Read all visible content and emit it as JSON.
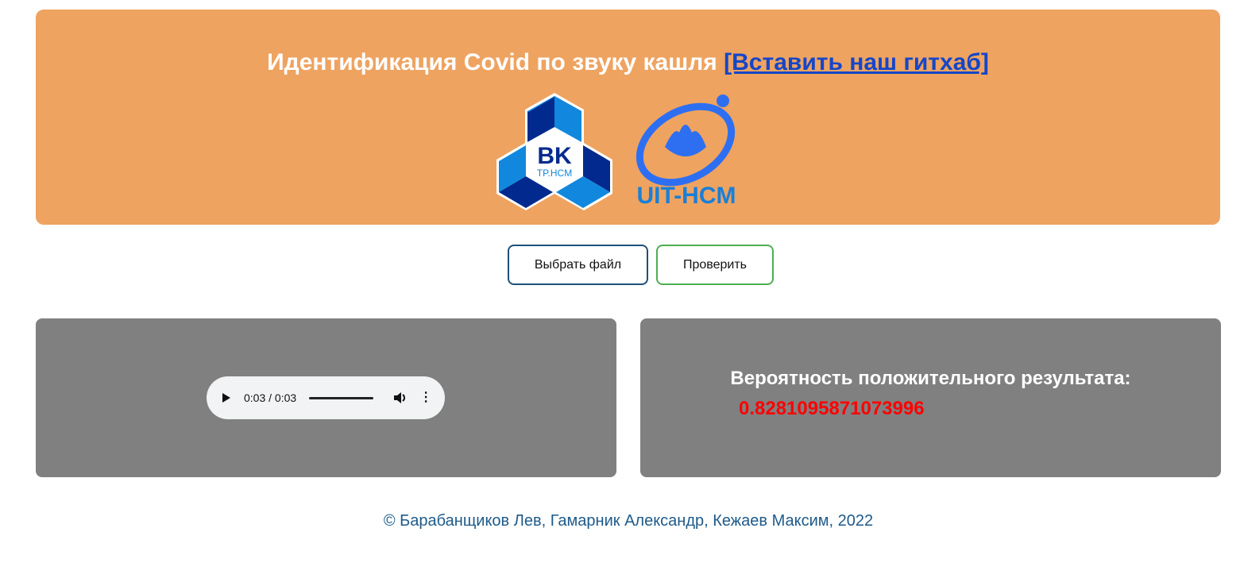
{
  "header": {
    "title": "Идентификация Covid по звуку кашля",
    "link_text": "[Вставить наш гитхаб]",
    "logos": [
      {
        "name": "BK",
        "subtitle": "TP.HCM"
      },
      {
        "name": "UIT-HCM"
      }
    ]
  },
  "actions": {
    "choose_file": "Выбрать файл",
    "check": "Проверить"
  },
  "audio": {
    "time": "0:03 / 0:03",
    "progress": 1.0
  },
  "result": {
    "label": "Вероятность положительного результата:",
    "value": "0.8281095871073996",
    "value_color": "#ff0000"
  },
  "footer": {
    "text": "© Барабанщиков Лев, Гамарник Александр, Кежаев Максим, 2022"
  },
  "colors": {
    "header_bg": "#eea360",
    "panel_bg": "#808080"
  }
}
